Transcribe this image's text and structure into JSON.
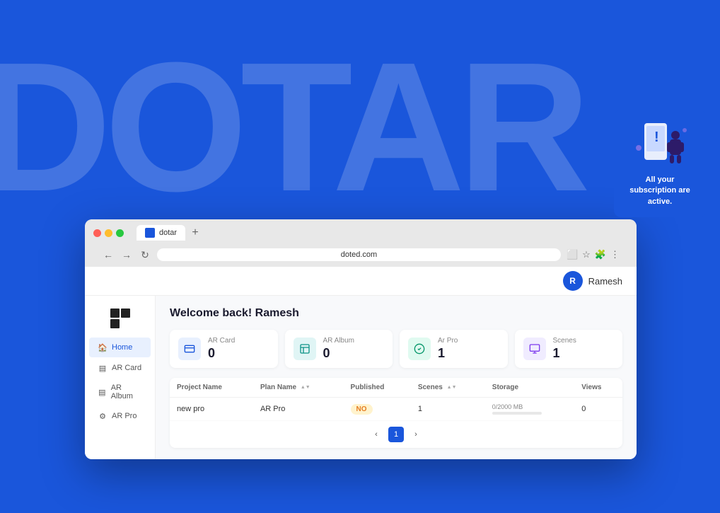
{
  "background": {
    "text": "DOTAR",
    "color": "#1a56db"
  },
  "browser": {
    "tab_label": "dotar",
    "address": "doted.com",
    "new_tab_symbol": "+"
  },
  "header": {
    "avatar_letter": "R",
    "username": "Ramesh"
  },
  "sidebar": {
    "items": [
      {
        "label": "Home",
        "icon": "🏠",
        "active": true
      },
      {
        "label": "AR Card",
        "icon": "□",
        "active": false
      },
      {
        "label": "AR Album",
        "icon": "□",
        "active": false
      },
      {
        "label": "AR Pro",
        "icon": "⚙",
        "active": false
      }
    ]
  },
  "main": {
    "welcome": "Welcome back! Ramesh",
    "stats": [
      {
        "label": "AR Card",
        "value": "0",
        "icon_type": "blue"
      },
      {
        "label": "AR Album",
        "value": "0",
        "icon_type": "teal"
      },
      {
        "label": "Ar Pro",
        "value": "1",
        "icon_type": "green"
      },
      {
        "label": "Scenes",
        "value": "1",
        "icon_type": "purple"
      }
    ],
    "table": {
      "columns": [
        "Project Name",
        "Plan Name",
        "Published",
        "Scenes",
        "Storage",
        "Views"
      ],
      "rows": [
        {
          "project_name": "new pro",
          "plan_name": "AR Pro",
          "published": "NO",
          "scenes": "1",
          "storage": "0/2000 MB",
          "views": "0"
        }
      ]
    },
    "pagination": {
      "current": "1",
      "prev": "‹",
      "next": "›"
    }
  },
  "subscription_card": {
    "text": "All your subscription are active."
  }
}
